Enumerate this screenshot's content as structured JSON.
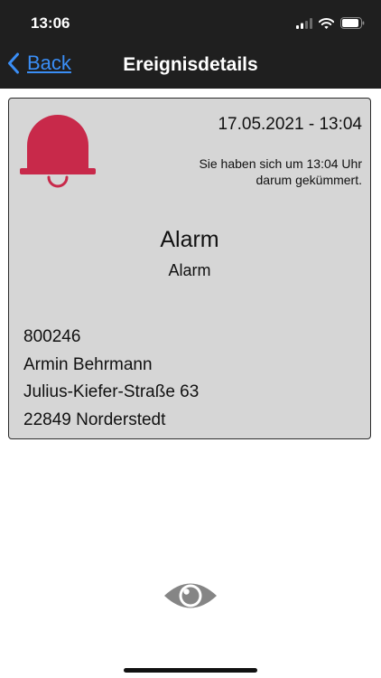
{
  "status_bar": {
    "time": "13:06"
  },
  "nav": {
    "back_label": "Back",
    "title": "Ereignisdetails"
  },
  "event": {
    "icon": "bell-icon",
    "datetime": "17.05.2021 - 13:04",
    "care_note_line1": "Sie haben sich um 13:04 Uhr",
    "care_note_line2": "darum gekümmert.",
    "type": "Alarm",
    "subtype": "Alarm",
    "contact": {
      "id": "800246",
      "name": "Armin Behrmann",
      "street": "Julius-Kiefer-Straße 63",
      "city": "22849 Norderstedt"
    }
  },
  "actions": {
    "view_icon": "eye-icon"
  },
  "colors": {
    "nav_background": "#1f1f1f",
    "accent_link": "#3a8ef6",
    "bell_red": "#c8294a",
    "card_background": "#d6d6d6",
    "eye_gray": "#858585"
  }
}
